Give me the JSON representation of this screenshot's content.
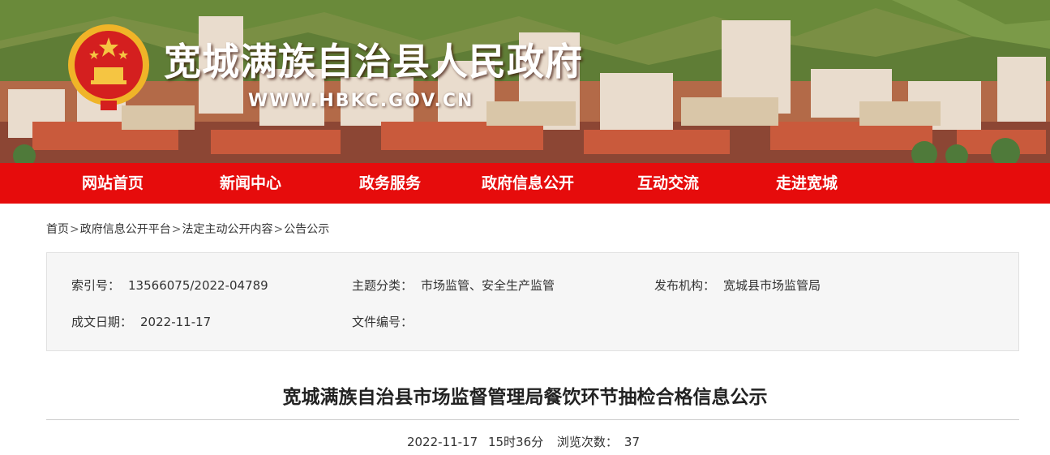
{
  "banner": {
    "title": "宽城满族自治县人民政府",
    "url": "WWW.HBKC.GOV.CN"
  },
  "nav": {
    "items": [
      {
        "label": "网站首页"
      },
      {
        "label": "新闻中心"
      },
      {
        "label": "政务服务"
      },
      {
        "label": "政府信息公开"
      },
      {
        "label": "互动交流"
      },
      {
        "label": "走进宽城"
      }
    ],
    "color": "#e60c0c"
  },
  "breadcrumb": {
    "items": [
      "首页",
      "政府信息公开平台",
      "法定主动公开内容",
      "公告公示"
    ],
    "separator": ">"
  },
  "meta": {
    "index_label": "索引号：",
    "index_value": "13566075/2022-04789",
    "topic_label": "主题分类：",
    "topic_value": "市场监管、安全生产监管",
    "publisher_label": "发布机构：",
    "publisher_value": "宽城县市场监管局",
    "date_label": "成文日期：",
    "date_value": "2022-11-17",
    "docno_label": "文件编号：",
    "docno_value": ""
  },
  "article": {
    "title": "宽城满族自治县市场监督管理局餐饮环节抽检合格信息公示",
    "date": "2022-11-17",
    "time": "15时36分",
    "views_label": "浏览次数：",
    "views_value": "37"
  },
  "icons": {
    "emblem": "national-emblem-icon"
  }
}
